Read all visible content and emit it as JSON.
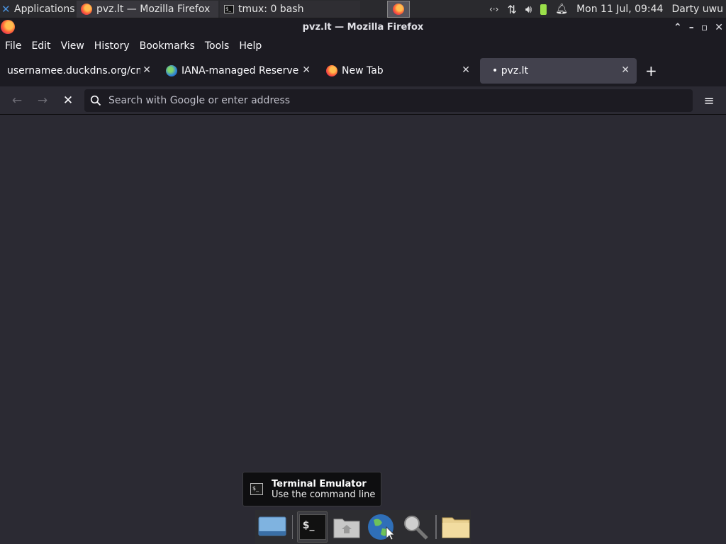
{
  "panel": {
    "apps_label": "Applications",
    "task1": "pvz.lt — Mozilla Firefox",
    "task2": "tmux: 0 bash",
    "datetime": "Mon 11 Jul, 09:44",
    "user": "Darty uwu"
  },
  "window": {
    "title": "pvz.lt — Mozilla Firefox"
  },
  "menu": {
    "file": "File",
    "edit": "Edit",
    "view": "View",
    "history": "History",
    "bookmarks": "Bookmarks",
    "tools": "Tools",
    "help": "Help"
  },
  "tabs": [
    {
      "label": "usernamee.duckdns.org/cm"
    },
    {
      "label": "IANA-managed Reserved"
    },
    {
      "label": "New Tab"
    },
    {
      "label": "• pvz.lt"
    }
  ],
  "urlbar": {
    "placeholder": "Search with Google or enter address"
  },
  "tooltip": {
    "title": "Terminal Emulator",
    "subtitle": "Use the command line"
  },
  "colors": {
    "accent": "#ff7139",
    "background": "#2b2a33",
    "toolbar": "#1c1b22"
  }
}
